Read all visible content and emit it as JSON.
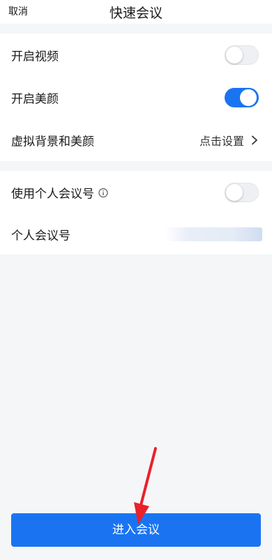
{
  "header": {
    "cancel_label": "取消",
    "title": "快速会议"
  },
  "settings": {
    "video": {
      "label": "开启视频",
      "enabled": false
    },
    "beauty": {
      "label": "开启美颜",
      "enabled": true
    },
    "virtual_bg": {
      "label": "虚拟背景和美颜",
      "value": "点击设置"
    },
    "personal_id_toggle": {
      "label": "使用个人会议号",
      "enabled": false
    },
    "personal_id": {
      "label": "个人会议号"
    }
  },
  "actions": {
    "enter_label": "进入会议"
  },
  "colors": {
    "accent": "#1a74f2",
    "annotation_arrow": "#e8212b"
  },
  "icons": {
    "info": "info-icon",
    "chevron": "chevron-right-icon",
    "annotation": "red-arrow-icon"
  }
}
